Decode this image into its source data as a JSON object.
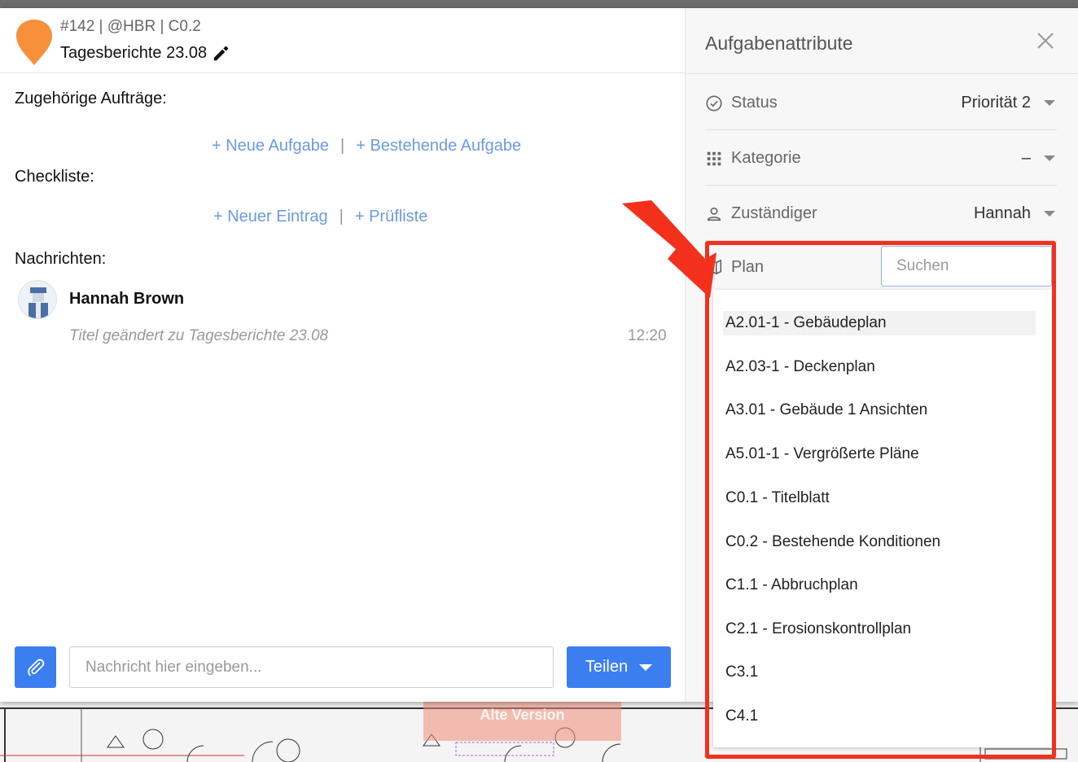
{
  "background": {
    "watermark": "Alte Version"
  },
  "task": {
    "meta": "#142 | @HBR | C0.2",
    "title": "Tagesberichte 23.08"
  },
  "sections": {
    "related": "Zugehörige Aufträge:",
    "new_task": "+ Neue Aufgabe",
    "existing_task": "+ Bestehende Aufgabe",
    "checklist": "Checkliste:",
    "new_entry": "+ Neuer Eintrag",
    "checklist_template": "+ Prüfliste",
    "separator": "|",
    "messages": "Nachrichten:"
  },
  "message": {
    "author": "Hannah Brown",
    "text": "Titel geändert zu Tagesberichte 23.08",
    "time": "12:20"
  },
  "composer": {
    "placeholder": "Nachricht hier eingeben...",
    "share": "Teilen"
  },
  "attributes": {
    "title": "Aufgabenattribute",
    "status_label": "Status",
    "status_value": "Priorität 2",
    "category_label": "Kategorie",
    "category_value": "–",
    "assignee_label": "Zuständiger",
    "assignee_value": "Hannah",
    "plan_label": "Plan",
    "search_placeholder": "Suchen"
  },
  "plans": [
    "A2.01-1 - Gebäudeplan",
    "A2.03-1 - Deckenplan",
    "A3.01 - Gebäude 1 Ansichten",
    "A5.01-1 - Vergrößerte Pläne",
    "C0.1 - Titelblatt",
    "C0.2 - Bestehende Konditionen",
    "C1.1 - Abbruchplan",
    "C2.1 - Erosionskontrollplan",
    "C3.1",
    "C4.1"
  ],
  "colors": {
    "accent": "#3b7ef0",
    "link": "#6b9be0",
    "highlight": "#f3301c",
    "pin": "#f7903a"
  }
}
